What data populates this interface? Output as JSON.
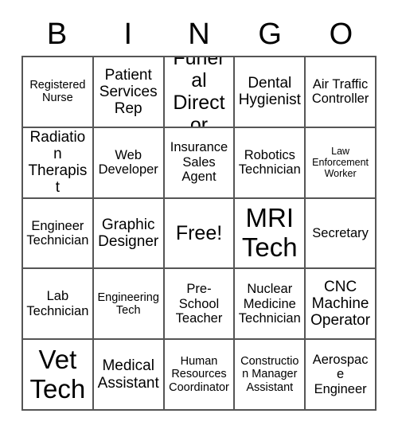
{
  "card": {
    "header_letters": [
      "B",
      "I",
      "N",
      "G",
      "O"
    ],
    "rows": [
      [
        {
          "text": "Registered Nurse",
          "size": "fs-sm"
        },
        {
          "text": "Patient Services Rep",
          "size": "fs-lg"
        },
        {
          "text": "Funeral Director",
          "size": "fs-xl"
        },
        {
          "text": "Dental Hygienist",
          "size": "fs-lg"
        },
        {
          "text": "Air Traffic Controller",
          "size": "fs-md"
        }
      ],
      [
        {
          "text": "Radiation Therapist",
          "size": "fs-lg"
        },
        {
          "text": "Web Developer",
          "size": "fs-md"
        },
        {
          "text": "Insurance Sales Agent",
          "size": "fs-md"
        },
        {
          "text": "Robotics Technician",
          "size": "fs-md"
        },
        {
          "text": "Law Enforcement Worker",
          "size": "fs-xs"
        }
      ],
      [
        {
          "text": "Engineer Technician",
          "size": "fs-md"
        },
        {
          "text": "Graphic Designer",
          "size": "fs-lg"
        },
        {
          "text": "Free!",
          "size": "fs-xl"
        },
        {
          "text": "MRI Tech",
          "size": "fs-xxl"
        },
        {
          "text": "Secretary",
          "size": "fs-md"
        }
      ],
      [
        {
          "text": "Lab Technician",
          "size": "fs-md"
        },
        {
          "text": "Engineering Tech",
          "size": "fs-sm"
        },
        {
          "text": "Pre-School Teacher",
          "size": "fs-md"
        },
        {
          "text": "Nuclear Medicine Technician",
          "size": "fs-md"
        },
        {
          "text": "CNC Machine Operator",
          "size": "fs-lg"
        }
      ],
      [
        {
          "text": "Vet Tech",
          "size": "fs-xxl"
        },
        {
          "text": "Medical Assistant",
          "size": "fs-lg"
        },
        {
          "text": "Human Resources Coordinator",
          "size": "fs-sm"
        },
        {
          "text": "Construction Manager Assistant",
          "size": "fs-sm"
        },
        {
          "text": "Aerospace Engineer",
          "size": "fs-md"
        }
      ]
    ]
  },
  "colors": {
    "border": "#555555",
    "text": "#000000",
    "background": "#ffffff"
  }
}
